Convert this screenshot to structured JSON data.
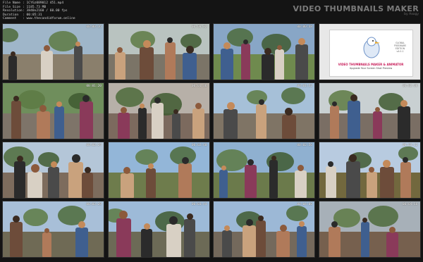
{
  "header": {
    "meta": [
      {
        "key": "File Name",
        "value": ": 1CYGz089012 451.mp4"
      },
      {
        "key": "File Size",
        "value": ": 1185.73 MB"
      },
      {
        "key": "Resolution",
        "value": ": 3840x2160 / 60.00 fps"
      },
      {
        "key": "Duration",
        "value": ": 00:05:31"
      },
      {
        "key": "Comment",
        "value": ": www.thecandidforum.online"
      }
    ],
    "brand": "VIDEO THUMBNAILS MAKER",
    "brand_sub": "by Axogy"
  },
  "promo": {
    "title": "VIDEO THUMBNAILS MAKER & ANIMATOR",
    "subtitle": "Upgrade Your Screen Shot Preview",
    "badge": [
      "GLOBAL",
      "FREEWARE",
      "EDITION",
      "v4.0.1"
    ]
  },
  "thumbs": [
    {
      "ts": "00:00:16",
      "sky": "#9fb6c9",
      "ground": "#8a7f6c"
    },
    {
      "ts": "00:00:32",
      "sky": "#b9c3c0",
      "ground": "#7b7467"
    },
    {
      "ts": "00:00:48",
      "sky": "#88a6c6",
      "ground": "#6f8a4e"
    },
    {
      "ts": "",
      "promo": true
    },
    {
      "ts": "00:01:20",
      "sky": "#6f8e5c",
      "ground": "#7e7469"
    },
    {
      "ts": "00:01:36",
      "sky": "#b7b0a8",
      "ground": "#7c6a5e"
    },
    {
      "ts": "00:01:52",
      "sky": "#a6c0d8",
      "ground": "#7f7465"
    },
    {
      "ts": "00:02:08",
      "sky": "#c9d0d2",
      "ground": "#7a6e64"
    },
    {
      "ts": "00:02:24",
      "sky": "#b4c6d8",
      "ground": "#7d6c5d"
    },
    {
      "ts": "00:02:40",
      "sky": "#93b6d8",
      "ground": "#6e7c4c"
    },
    {
      "ts": "00:02:56",
      "sky": "#8fb0d0",
      "ground": "#6b7a4b"
    },
    {
      "ts": "00:03:12",
      "sky": "#b8cbe0",
      "ground": "#72683e"
    },
    {
      "ts": "00:03:28",
      "sky": "#a8bfd8",
      "ground": "#6f6a55"
    },
    {
      "ts": "00:03:44",
      "sky": "#9dbad8",
      "ground": "#6c6a56"
    },
    {
      "ts": "00:04:00",
      "sky": "#9cb8d6",
      "ground": "#74695c"
    },
    {
      "ts": "00:04:16",
      "sky": "#a7b0b8",
      "ground": "#76604e"
    }
  ]
}
